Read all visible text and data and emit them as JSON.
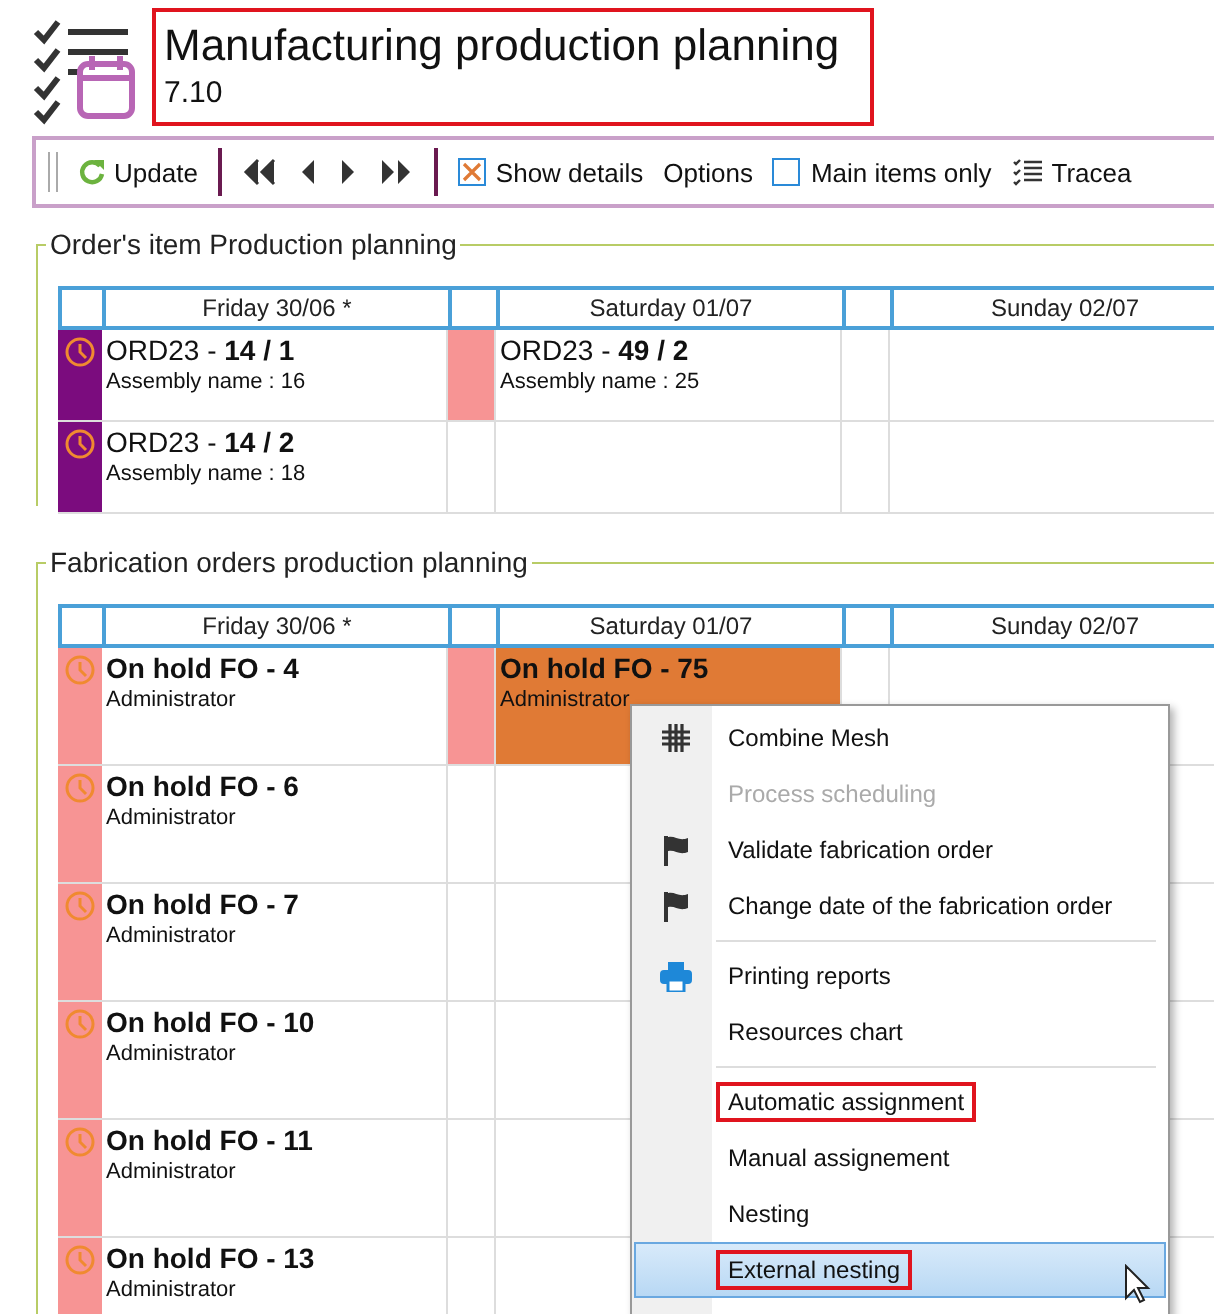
{
  "app": {
    "title": "Manufacturing production planning",
    "version": "7.10",
    "annotated": true
  },
  "toolbar": [
    {
      "kind": "refresh",
      "label": "Update"
    },
    {
      "kind": "first"
    },
    {
      "kind": "prev"
    },
    {
      "kind": "next"
    },
    {
      "kind": "last"
    },
    {
      "kind": "checkbox",
      "label": "Show details",
      "checked": true
    },
    {
      "kind": "link",
      "label": "Options"
    },
    {
      "kind": "checkbox",
      "label": "Main items only",
      "checked": false
    },
    {
      "kind": "list",
      "label": "Tracea"
    }
  ],
  "sections": [
    {
      "title": "Order's item Production planning",
      "days": [
        "Friday 30/06  *",
        "Saturday 01/07",
        "Sunday 02/07"
      ],
      "kind": "items",
      "rows": [
        {
          "color": "#7b0c7e",
          "friday": {
            "title": "ORD23 - **14 / 1**",
            "subtitle": "Assembly name : 16"
          },
          "saturday_flag": {
            "color": "#f79494"
          },
          "saturday": {
            "title": "ORD23 - **49 / 2**",
            "subtitle": "Assembly name : 25"
          }
        },
        {
          "color": "#7b0c7e",
          "friday": {
            "title": "ORD23 - **14 / 2**",
            "subtitle": "Assembly name : 18"
          }
        }
      ]
    },
    {
      "title": "Fabrication orders production planning",
      "days": [
        "Friday 30/06  *",
        "Saturday 01/07",
        "Sunday 02/07"
      ],
      "kind": "orders",
      "rows": [
        {
          "color": "#f79494",
          "friday": {
            "title": "On hold FO - 4",
            "subtitle": "Administrator"
          },
          "saturday_flag": {
            "color": "#f79494"
          },
          "saturday": {
            "title": "On hold FO - 75",
            "subtitle": "Administrator",
            "color": "#e07a35"
          }
        },
        {
          "color": "#f79494",
          "friday": {
            "title": "On hold FO - 6",
            "subtitle": "Administrator"
          }
        },
        {
          "color": "#f79494",
          "friday": {
            "title": "On hold FO - 7",
            "subtitle": "Administrator"
          }
        },
        {
          "color": "#f79494",
          "friday": {
            "title": "On hold FO - 10",
            "subtitle": "Administrator"
          }
        },
        {
          "color": "#f79494",
          "friday": {
            "title": "On hold FO - 11",
            "subtitle": "Administrator"
          }
        },
        {
          "color": "#f79494",
          "friday": {
            "title": "On hold FO - 13",
            "subtitle": "Administrator"
          }
        }
      ]
    }
  ],
  "context_menu": [
    {
      "label": "Combine Mesh",
      "kind": "grid",
      "disabled": false,
      "selected": false,
      "annotated": false,
      "separator_before": false
    },
    {
      "label": "Process scheduling",
      "kind": "none",
      "disabled": true,
      "selected": false,
      "annotated": false,
      "separator_before": false
    },
    {
      "label": "Validate fabrication order",
      "kind": "flag",
      "disabled": false,
      "selected": false,
      "annotated": false,
      "separator_before": false
    },
    {
      "label": "Change date of the fabrication order",
      "kind": "flag",
      "disabled": false,
      "selected": false,
      "annotated": false,
      "separator_before": false
    },
    {
      "label": "Printing reports",
      "kind": "printer",
      "disabled": false,
      "selected": false,
      "annotated": false,
      "separator_before": true
    },
    {
      "label": "Resources chart",
      "kind": "none",
      "disabled": false,
      "selected": false,
      "annotated": false,
      "separator_before": false
    },
    {
      "label": "Automatic assignment",
      "kind": "none",
      "disabled": false,
      "selected": false,
      "annotated": true,
      "separator_before": true
    },
    {
      "label": "Manual assignement",
      "kind": "none",
      "disabled": false,
      "selected": false,
      "annotated": false,
      "separator_before": false
    },
    {
      "label": "Nesting",
      "kind": "none",
      "disabled": false,
      "selected": false,
      "annotated": false,
      "separator_before": false
    },
    {
      "label": "External nesting",
      "kind": "none",
      "disabled": false,
      "selected": true,
      "annotated": true,
      "separator_before": false
    }
  ]
}
